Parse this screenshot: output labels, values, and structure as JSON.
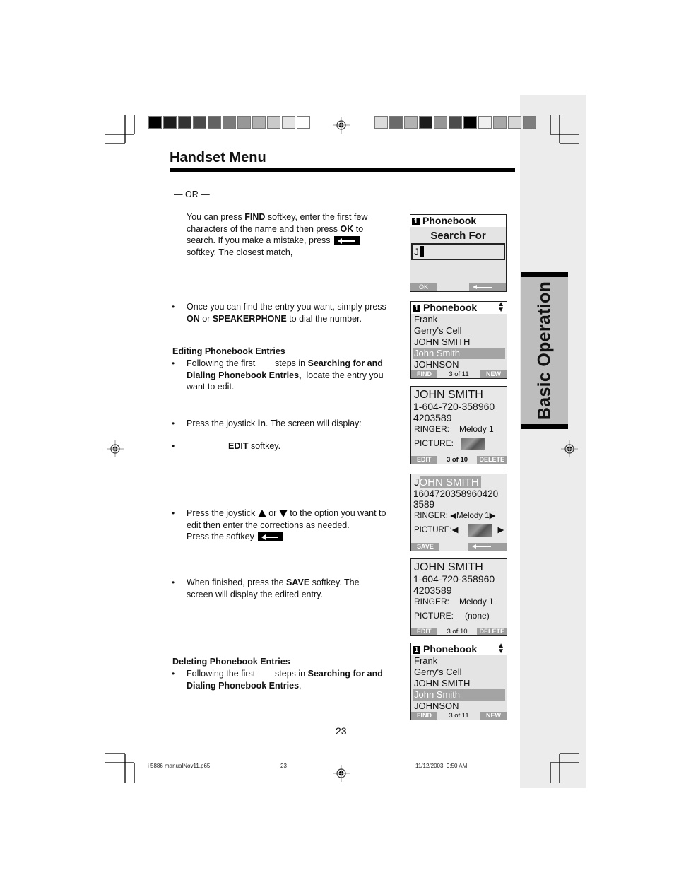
{
  "header": {
    "title": "Handset Menu",
    "left_swatches": [
      "#000000",
      "#1c1c1c",
      "#333333",
      "#4b4b4b",
      "#616161",
      "#7b7b7b",
      "#979797",
      "#b0b0b0",
      "#cacaca",
      "#e4e4e4",
      "#ffffff"
    ],
    "right_swatches": [
      "#dcdcdc",
      "#6a6a6a",
      "#b2b2b2",
      "#1d1d1d",
      "#969696",
      "#4c4c4c",
      "#000000",
      "#f0f0f0",
      "#a8a8a8",
      "#d6d6d6",
      "#7e7e7e"
    ]
  },
  "side_tab": {
    "label": "Basic Operation"
  },
  "content": {
    "or_divider": "—   OR   —",
    "find_para": {
      "t1": "You can press ",
      "b1": "FIND",
      "t2": " softkey, enter the first few characters of the name and then press ",
      "b2": "OK",
      "t3": " to search. If you make a mistake, press ",
      "t4": " softkey. The closest match,"
    },
    "dial_bullet": {
      "t1": "Once you can find the entry you want, simply press ",
      "b1": "ON",
      "t2": " or ",
      "b2": "SPEAKERPHONE",
      "t3": " to dial the number."
    },
    "editing_heading": "Editing Phonebook Entries",
    "edit_bullet1": {
      "t1": "Following the first        steps in ",
      "b1": "Searching for and Dialing Phonebook Entries,",
      "t2": "  locate the entry you want to edit."
    },
    "edit_bullet2": {
      "t1": "Press the joystick ",
      "b1": "in",
      "t2": ". The screen will display:"
    },
    "edit_bullet3": {
      "b1": "EDIT",
      "t1": " softkey."
    },
    "edit_bullet4": {
      "t1": "Press the joystick ",
      "t2": " or ",
      "t3": "  to the option you want to edit then enter the corrections as needed.",
      "t4": "Press the softkey"
    },
    "edit_bullet5": {
      "t1": "When finished, press the ",
      "b1": "SAVE",
      "t2": " softkey. The screen will display the edited entry."
    },
    "deleting_heading": "Deleting Phonebook Entries",
    "delete_bullet1": {
      "t1": "Following the first        steps in ",
      "b1": "Searching for and Dialing Phonebook Entries",
      "t2": ","
    },
    "bullet_char": "•",
    "page_number": "23"
  },
  "screens": {
    "search": {
      "badge": "1",
      "title": "Phonebook",
      "heading": "Search For",
      "input_value": "J",
      "left_softkey": "OK"
    },
    "list1": {
      "badge": "1",
      "title": "Phonebook",
      "scroll_icon": "⬍",
      "rows": [
        "Frank",
        "Gerry's  Cell",
        "JOHN SMITH",
        "John Smith",
        "JOHNSON"
      ],
      "selected_index": 3,
      "left_softkey": "FIND",
      "position": "3 of 11",
      "right_softkey": "NEW"
    },
    "detail1": {
      "name": "JOHN SMITH",
      "phone1": "1-604-720-358960",
      "phone2": "4203589",
      "ringer_label": "RINGER:",
      "ringer_value": "Melody 1",
      "picture_label": "PICTURE:",
      "left_softkey": "EDIT",
      "position": "3 of 10",
      "right_softkey": "DELETE"
    },
    "edit": {
      "name_cursor": "J",
      "name_rest": "OHN SMITH",
      "phone1": "1604720358960420",
      "phone2": "3589",
      "ringer_label": "RINGER:",
      "ringer_value": "Melody 1",
      "picture_label": "PICTURE:",
      "left_softkey": "SAVE"
    },
    "detail2": {
      "name": "JOHN SMITH",
      "phone1": "1-604-720-358960",
      "phone2": "4203589",
      "ringer_label": "RINGER:",
      "ringer_value": "Melody 1",
      "picture_label": "PICTURE:",
      "picture_value": "(none)",
      "left_softkey": "EDIT",
      "position": "3 of 10",
      "right_softkey": "DELETE"
    },
    "list2": {
      "badge": "1",
      "title": "Phonebook",
      "scroll_icon": "⬍",
      "rows": [
        "Frank",
        "Gerry's  Cell",
        "JOHN SMITH",
        "John Smith",
        "JOHNSON"
      ],
      "selected_index": 3,
      "left_softkey": "FIND",
      "position": "3 of 11",
      "right_softkey": "NEW"
    }
  },
  "footer": {
    "filename": "i 5886 manualNov11.p65",
    "page": "23",
    "timestamp": "11/12/2003, 9:50 AM"
  }
}
